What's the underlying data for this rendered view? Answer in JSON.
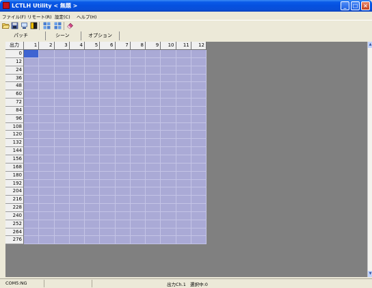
{
  "window": {
    "title": "LCTLH Utility  < 無題 >",
    "min_glyph": "_",
    "max_glyph": "□",
    "close_glyph": "×"
  },
  "menu": [
    "ファイル(F)",
    "リモート(R)",
    "設定(C)",
    "ヘルプ(H)"
  ],
  "toolbar": {
    "icons": [
      "open-folder-icon",
      "save-icon",
      "connect-icon",
      "send-icon",
      "grid-icon",
      "grid-alt-icon",
      "eraser-icon"
    ]
  },
  "tabs": [
    "パッチ",
    "シーン",
    "オプション"
  ],
  "grid": {
    "corner_label": "出力",
    "columns": [
      "1",
      "2",
      "3",
      "4",
      "5",
      "6",
      "7",
      "8",
      "9",
      "10",
      "11",
      "12"
    ],
    "rows": [
      "0",
      "12",
      "24",
      "36",
      "48",
      "60",
      "72",
      "84",
      "96",
      "108",
      "120",
      "132",
      "144",
      "156",
      "168",
      "180",
      "192",
      "204",
      "216",
      "228",
      "240",
      "252",
      "264",
      "276"
    ],
    "selected_cell": {
      "row": 0,
      "col": 0
    },
    "cell_color": "#aaaad6",
    "selected_color": "#3f64d2"
  },
  "scrollbar": {
    "up_glyph": "▲",
    "down_glyph": "▼"
  },
  "status": {
    "port": "COM5:NG",
    "output_channel": "出力Ch.1",
    "selection": "選択中:0"
  }
}
